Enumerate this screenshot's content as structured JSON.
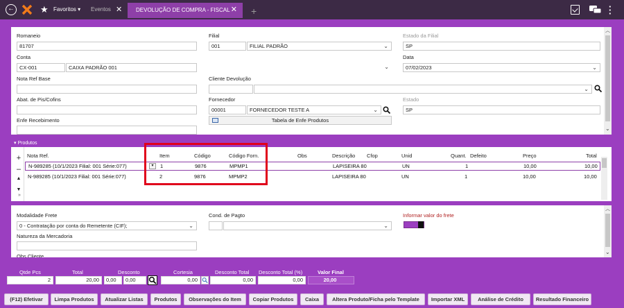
{
  "topbar": {
    "favoritos": "Favoritos",
    "eventos": "Eventos",
    "active_tab": "DEVOLUÇÃO DE COMPRA - FISCAL",
    "icons": [
      "back-icon",
      "logo-icon",
      "star-icon",
      "close-icon",
      "plus-icon",
      "clipboard-icon",
      "chat-icon",
      "more-icon"
    ]
  },
  "header": {
    "romaneio_label": "Romaneio",
    "romaneio_value": "81707",
    "filial_label": "Filial",
    "filial_code": "001",
    "filial_name": "FILIAL PADRÃO",
    "estado_filial_label": "Estado da Filial",
    "estado_filial_value": "SP",
    "conta_label": "Conta",
    "conta_code": "CX-001",
    "conta_name": "CAIXA PADRÃO 001",
    "data_label": "Data",
    "data_value": "07/02/2023",
    "nota_ref_base_label": "Nota Ref Base",
    "nota_ref_base_value": "",
    "cliente_devolucao_label": "Cliente Devolução",
    "abat_label": "Abat. de Pis/Cofins",
    "fornecedor_label": "Fornecedor",
    "fornecedor_code": "00001",
    "fornecedor_name": "FORNECEDOR TESTE A",
    "estado_label": "Estado",
    "estado_value": "SP",
    "enfe_label": "Enfe Recebimento",
    "tabela_enfe_button": "Tabela de Enfe Produtos"
  },
  "produtos": {
    "title": "Produtos",
    "columns": [
      "Nota Ref.",
      "Item",
      "Código",
      "Código Forn.",
      "Obs",
      "Descrição",
      "Cfop",
      "Unid",
      "Quant.",
      "Defeito",
      "Preço",
      "Total"
    ],
    "rows": [
      {
        "nota": "N-989285 (10/1/2023 Filial: 001 Série:077)",
        "item": "1",
        "codigo": "9876",
        "codigo_forn": "MPMP1",
        "obs": "",
        "descricao": "LAPISEIRA 80",
        "cfop": "",
        "unid": "UN",
        "quant": "1",
        "defeito": "",
        "preco": "10,00",
        "total": "10,00"
      },
      {
        "nota": "N-989285 (10/1/2023 Filial: 001 Série:077)",
        "item": "2",
        "codigo": "9876",
        "codigo_forn": "MPMP2",
        "obs": "",
        "descricao": "LAPISEIRA 80",
        "cfop": "",
        "unid": "UN",
        "quant": "1",
        "defeito": "",
        "preco": "10,00",
        "total": "10,00"
      }
    ]
  },
  "frete": {
    "modalidade_label": "Modalidade Frete",
    "modalidade_value": "0 - Contratação por conta do Remetente (CIF);",
    "cond_pagto_label": "Cond. de Pagto",
    "informar_label": "Informar valor do frete",
    "natureza_label": "Natureza da Mercadoria",
    "obs_cliente_label": "Obs Cliente"
  },
  "totals": {
    "qtde_pcs_label": "Qtde Pcs",
    "qtde_pcs_value": "2",
    "total_label": "Total",
    "total_value": "20,00",
    "desconto_label": "Desconto",
    "desconto_value_1": "0,00",
    "desconto_value_2": "0,00",
    "cortesia_label": "Cortesia",
    "cortesia_value": "0,00",
    "desconto_total_label": "Desconto Total",
    "desconto_total_value": "0,00",
    "desconto_total_pct_label": "Desconto Total (%)",
    "desconto_total_pct_value": "0,00",
    "valor_final_label": "Valor Final",
    "valor_final_value": "20,00"
  },
  "buttons": [
    "(F12) Efetivar",
    "Limpa Produtos",
    "Atualizar Listas",
    "Produtos",
    "Observações do Item",
    "Copiar Produtos",
    "Caixa",
    "Altera Produto/Ficha pelo Template",
    "Importar XML",
    "Análise de Crédito",
    "Resultado Financeiro"
  ],
  "colors": {
    "brand": "#9b3ec0",
    "topbar": "#3c2a45",
    "highlight": "#e0001b"
  }
}
